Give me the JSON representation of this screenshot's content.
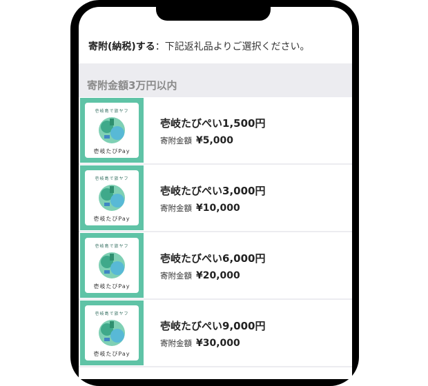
{
  "header": {
    "instruction_bold": "寄附(納税)する",
    "instruction_rest": "：下記返礼品よりご選択ください。"
  },
  "section": {
    "title": "寄附金額3万円以内"
  },
  "items": [
    {
      "name": "壱岐たびぺい1,500円",
      "price_label": "寄附金額",
      "price": "¥5,000",
      "thumb_top": "壱岐島で旅ヤフ",
      "thumb_bottom": "壱岐たびPay"
    },
    {
      "name": "壱岐たびぺい3,000円",
      "price_label": "寄附金額",
      "price": "¥10,000",
      "thumb_top": "壱岐島で旅ヤフ",
      "thumb_bottom": "壱岐たびPay"
    },
    {
      "name": "壱岐たびぺい6,000円",
      "price_label": "寄附金額",
      "price": "¥20,000",
      "thumb_top": "壱岐島で旅ヤフ",
      "thumb_bottom": "壱岐たびPay"
    },
    {
      "name": "壱岐たびぺい9,000円",
      "price_label": "寄附金額",
      "price": "¥30,000",
      "thumb_top": "壱岐島で旅ヤフ",
      "thumb_bottom": "壱岐たびPay"
    }
  ],
  "colors": {
    "thumb_border": "#5fc3a6",
    "band": "#ececf0",
    "frame": "#000000"
  }
}
